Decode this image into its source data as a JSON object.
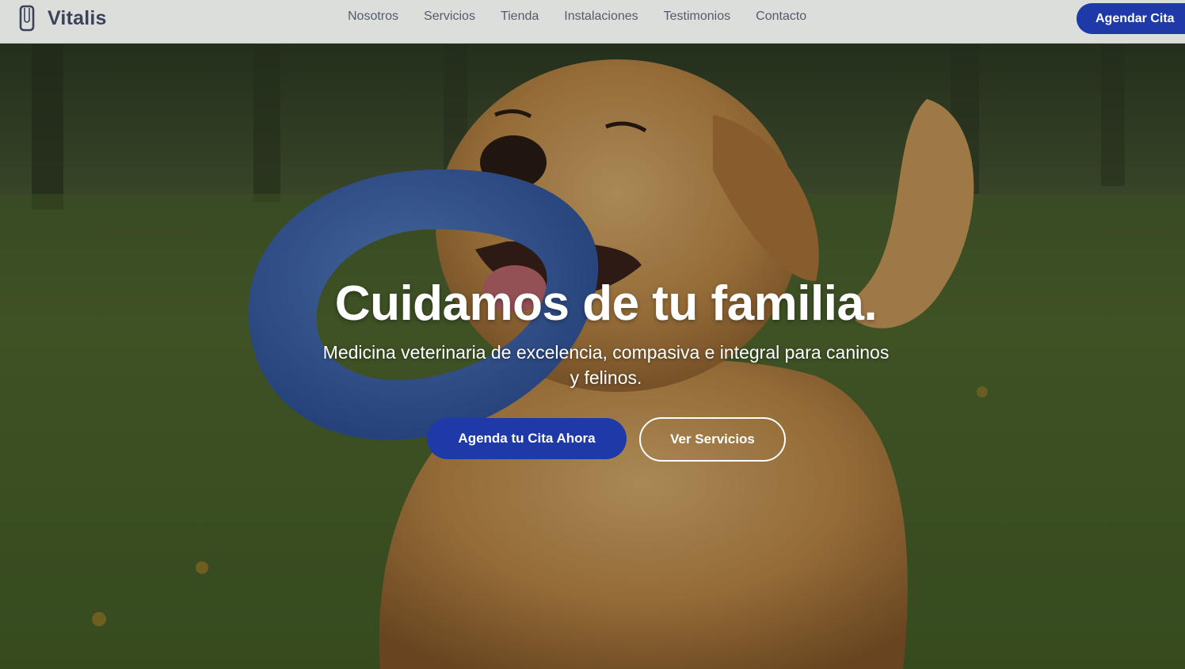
{
  "header": {
    "brand_name": "Vitalis",
    "brand_icon": "phone-outline-icon",
    "nav": [
      {
        "label": "Nosotros"
      },
      {
        "label": "Servicios"
      },
      {
        "label": "Tienda"
      },
      {
        "label": "Instalaciones"
      },
      {
        "label": "Testimonios"
      },
      {
        "label": "Contacto"
      }
    ],
    "cta_label": "Agendar Cita"
  },
  "hero": {
    "title": "Cuidamos de tu familia.",
    "subtitle": "Medicina veterinaria de excelencia, compasiva e integral para caninos y felinos.",
    "primary_button": "Agenda tu Cita Ahora",
    "secondary_button": "Ver Servicios"
  },
  "colors": {
    "primary": "#1d3aa8",
    "header_bg": "#dcdedb",
    "brand_text": "#3b4456",
    "nav_text": "#535c6a",
    "hero_text": "#ffffff"
  }
}
